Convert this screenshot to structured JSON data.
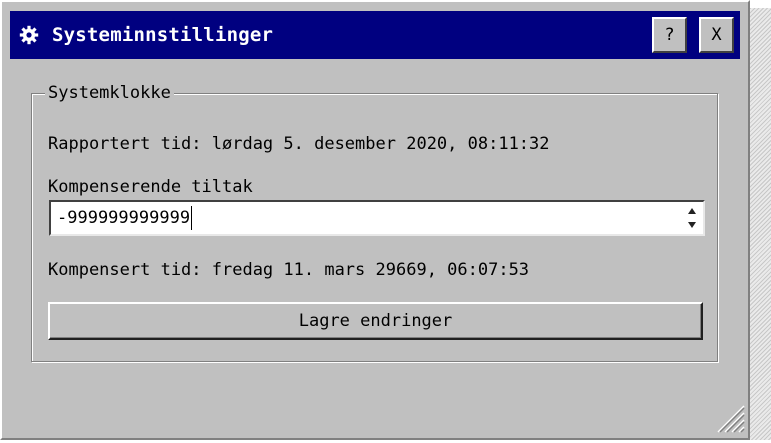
{
  "window": {
    "title": "Systeminnstillinger",
    "help_button": "?",
    "close_button": "X",
    "icon": "gear-icon"
  },
  "group": {
    "legend": "Systemklokke",
    "reported_time": "Rapportert tid: lørdag 5. desember 2020, 08:11:32",
    "compensation_label": "Kompenserende tiltak",
    "compensation_value": "-999999999999",
    "compensated_time": "Kompensert tid: fredag 11. mars 29669, 06:07:53",
    "save_button": "Lagre endringer"
  },
  "colors": {
    "titlebar": "#000080",
    "face": "#c0c0c0",
    "title_text": "#ffffff"
  }
}
